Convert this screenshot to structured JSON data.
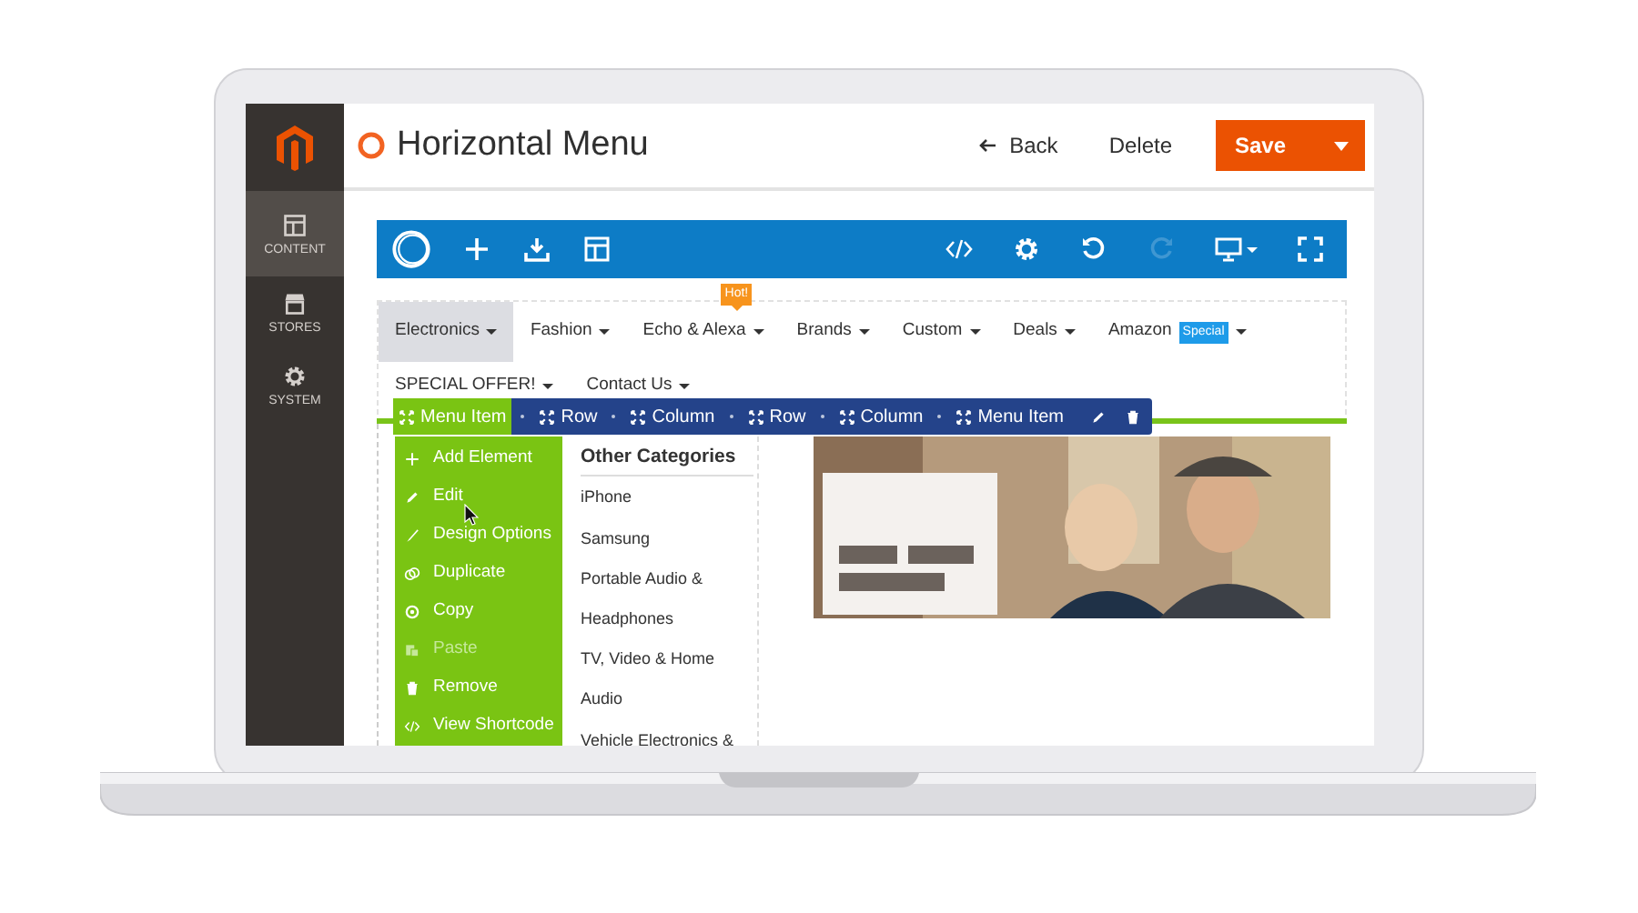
{
  "sidebar": {
    "items": [
      {
        "label": "CONTENT",
        "kind": "layout",
        "selected": true
      },
      {
        "label": "STORES",
        "kind": "store",
        "selected": false
      },
      {
        "label": "SYSTEM",
        "kind": "gear",
        "selected": false
      }
    ]
  },
  "header": {
    "title": "Horizontal Menu",
    "back": "Back",
    "delete": "Delete",
    "save": "Save"
  },
  "toolbar": {
    "left": [
      {
        "kind": "logo",
        "disabled": false
      },
      {
        "kind": "plus",
        "disabled": false
      },
      {
        "kind": "download",
        "disabled": false
      },
      {
        "kind": "layout",
        "disabled": false
      }
    ],
    "right": [
      {
        "kind": "code",
        "disabled": false
      },
      {
        "kind": "gear",
        "disabled": false
      },
      {
        "kind": "undo",
        "disabled": false
      },
      {
        "kind": "redo",
        "disabled": true
      },
      {
        "kind": "monitor",
        "disabled": false
      },
      {
        "kind": "fullscreen",
        "disabled": false
      }
    ]
  },
  "menu": {
    "rows": [
      [
        {
          "label": "Electronics",
          "selected": true
        },
        {
          "label": "Fashion",
          "selected": false
        },
        {
          "label": "Echo & Alexa",
          "selected": false,
          "badge": {
            "text": "Hot!",
            "color": "#f7941d",
            "kind": "callout"
          }
        },
        {
          "label": "Brands",
          "selected": false
        },
        {
          "label": "Custom",
          "selected": false
        },
        {
          "label": "Deals",
          "selected": false
        },
        {
          "label": "Amazon",
          "selected": false,
          "badge": {
            "text": "Special",
            "color": "#1e9be9",
            "kind": "tag"
          }
        }
      ],
      [
        {
          "label": "SPECIAL OFFER!",
          "selected": false
        },
        {
          "label": "Contact Us",
          "selected": false
        }
      ]
    ]
  },
  "breadcrumb": [
    {
      "label": "Menu Item",
      "selected": true
    },
    {
      "label": "Row",
      "selected": false
    },
    {
      "label": "Column",
      "selected": false
    },
    {
      "label": "Row",
      "selected": false
    },
    {
      "label": "Column",
      "selected": false
    },
    {
      "label": "Menu Item",
      "selected": false
    }
  ],
  "context_menu": [
    {
      "label": "Add Element",
      "kind": "plus",
      "disabled": false
    },
    {
      "label": "Edit",
      "kind": "pencil",
      "disabled": false
    },
    {
      "label": "Design Options",
      "kind": "brush",
      "disabled": false
    },
    {
      "label": "Duplicate",
      "kind": "duplicate",
      "disabled": false
    },
    {
      "label": "Copy",
      "kind": "copy",
      "disabled": false
    },
    {
      "label": "Paste",
      "kind": "paste",
      "disabled": true
    },
    {
      "label": "Remove",
      "kind": "trash",
      "disabled": false
    },
    {
      "label": "View Shortcode",
      "kind": "code",
      "disabled": false
    }
  ],
  "categories": {
    "heading": "Other Categories",
    "items": [
      "iPhone",
      "Samsung",
      "Portable Audio & Headphones",
      "TV, Video & Home Audio",
      "Vehicle Electronics &"
    ]
  }
}
